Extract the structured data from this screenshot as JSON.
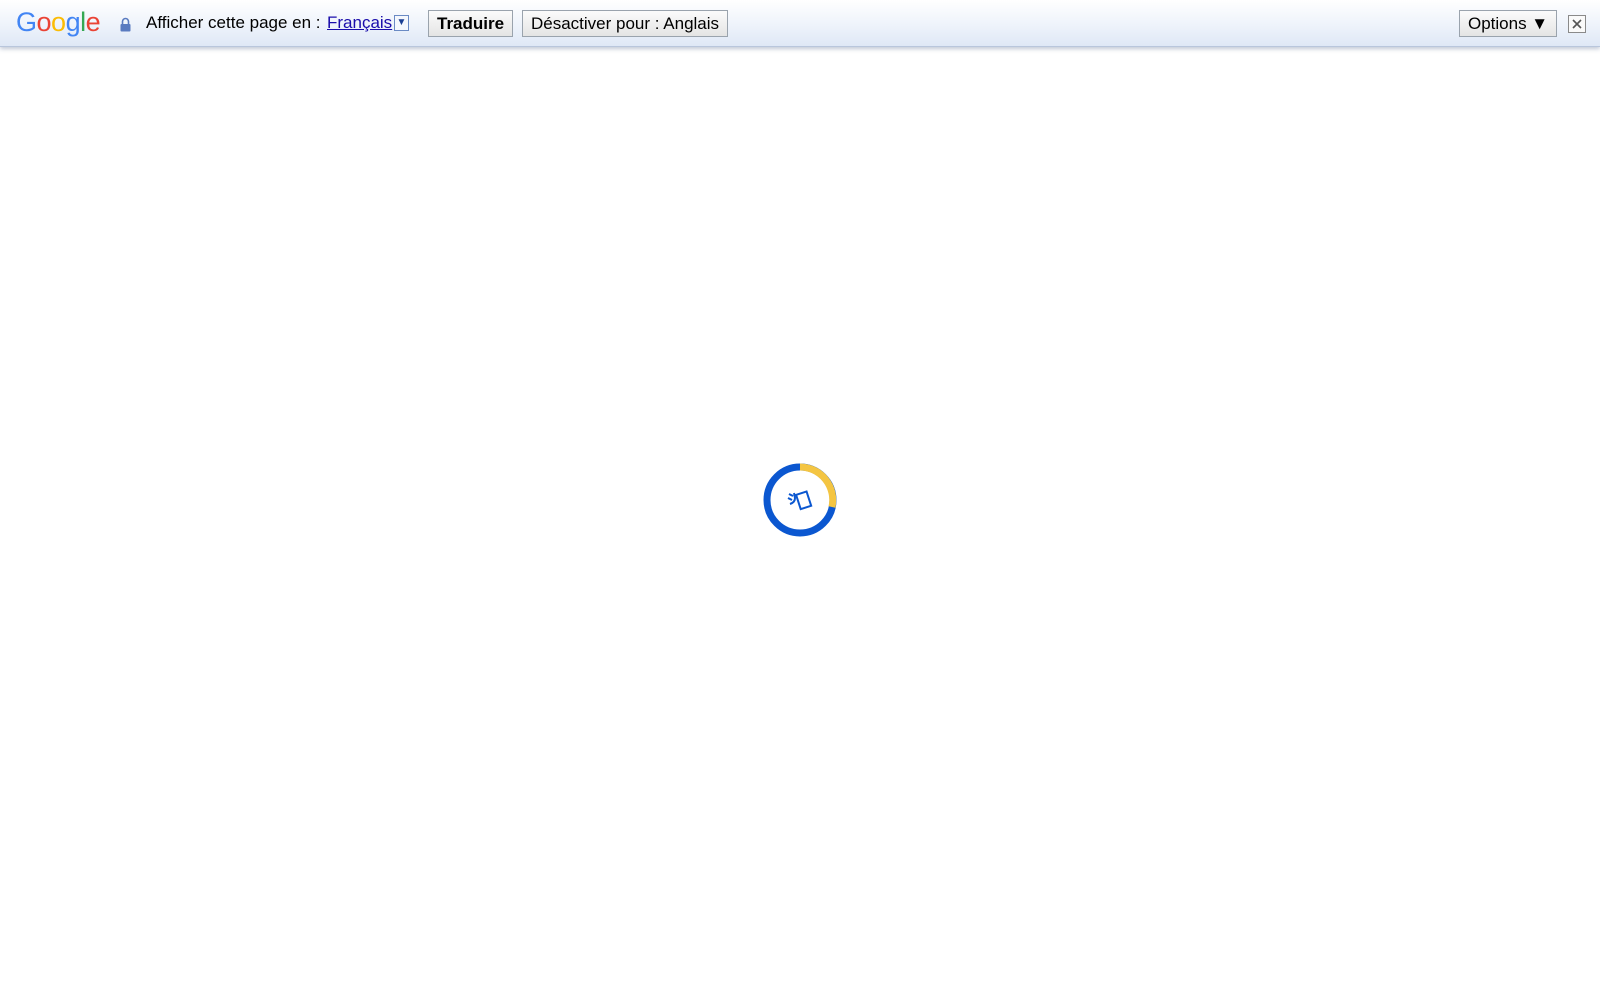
{
  "translate_bar": {
    "logo": {
      "letters": [
        "G",
        "o",
        "o",
        "g",
        "l",
        "e"
      ],
      "colors": [
        "#4285F4",
        "#EA4335",
        "#FBBC05",
        "#4285F4",
        "#34A853",
        "#EA4335"
      ]
    },
    "lock_icon": "lock-icon",
    "prompt": "Afficher cette page en :",
    "language": "Français",
    "language_dropdown_icon": "▼",
    "translate_button": "Traduire",
    "disable_button": "Désactiver pour : Anglais",
    "options_button": "Options ▼",
    "close_icon": "close-icon"
  },
  "loading": {
    "icon": "translate-spinner-icon",
    "colors": {
      "primary": "#0b57d0",
      "accent": "#f4c542"
    }
  }
}
